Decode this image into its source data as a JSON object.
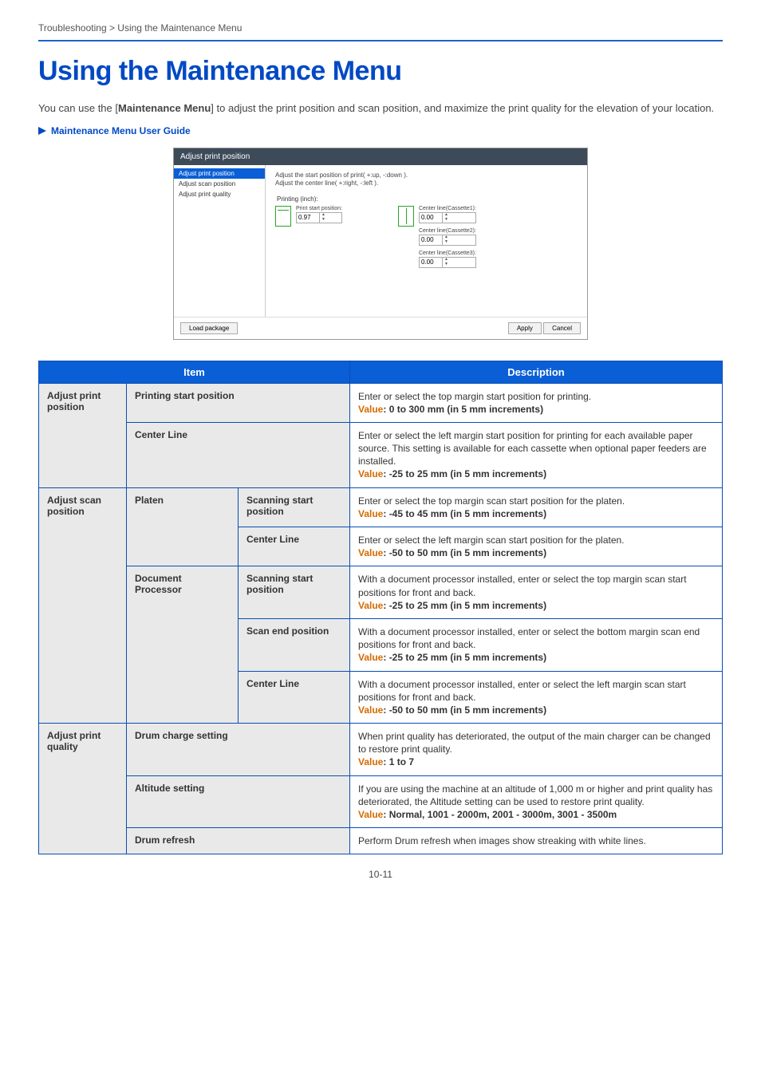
{
  "breadcrumb": "Troubleshooting > Using the Maintenance Menu",
  "title": "Using the Maintenance Menu",
  "intro_pre": "You can use the [",
  "intro_bold": "Maintenance Menu",
  "intro_post": "] to adjust the print position and scan position, and maximize the print quality for the elevation of your location.",
  "guide_link": "Maintenance Menu User Guide",
  "page_number": "10-11",
  "shot": {
    "title": "Adjust print position",
    "side": [
      "Adjust print position",
      "Adjust scan position",
      "Adjust print quality"
    ],
    "hint1": "Adjust the start position of print( +:up, -:down ).",
    "hint2": "Adjust the center line( +:right, -:left ).",
    "section": "Printing (inch):",
    "f_start_label": "Print start position:",
    "f_start_val": "0.97",
    "c1_label": "Center line(Cassette1):",
    "c1_val": "0.00",
    "c2_label": "Center line(Cassette2):",
    "c2_val": "0.00",
    "c3_label": "Center line(Cassette3):",
    "c3_val": "0.00",
    "btn_load": "Load package",
    "btn_apply": "Apply",
    "btn_cancel": "Cancel"
  },
  "table": {
    "head_item": "Item",
    "head_desc": "Description",
    "rows": {
      "r1": {
        "g": "Adjust print position",
        "sub": "Printing start position",
        "desc": "Enter or select the top margin start position for printing.",
        "val": ": 0 to 300 mm (in 5 mm increments)"
      },
      "r2": {
        "sub": "Center Line",
        "desc": "Enter or select the left margin start position for printing for each available paper source. This setting is available for each cassette when optional paper feeders are installed.",
        "val": ": -25 to 25 mm (in 5 mm increments)"
      },
      "r3": {
        "g": "Adjust scan position",
        "sub1": "Platen",
        "sub2": "Scanning start position",
        "desc": "Enter or select the top margin scan start position for the platen.",
        "val": ": -45 to 45 mm (in 5 mm increments)"
      },
      "r4": {
        "sub2": "Center Line",
        "desc": "Enter or select the left margin scan start position for the platen.",
        "val": ": -50 to 50 mm (in 5 mm increments)"
      },
      "r5": {
        "sub1": "Document Processor",
        "sub2": "Scanning start position",
        "desc": "With a document processor installed, enter or select the top margin scan start positions for front and back.",
        "val": ": -25 to 25 mm (in 5 mm increments)"
      },
      "r6": {
        "sub2": "Scan end position",
        "desc": "With a document processor installed, enter or select the bottom margin scan end positions for front and back.",
        "val": ": -25 to 25 mm (in 5 mm increments)"
      },
      "r7": {
        "sub2": "Center Line",
        "desc": "With a document processor installed, enter or select the left margin scan start positions for front and back.",
        "val": ": -50 to 50 mm (in 5 mm increments)"
      },
      "r8": {
        "g": "Adjust print quality",
        "sub": "Drum charge setting",
        "desc": "When print quality has deteriorated, the output of the main charger can be changed to restore print quality.",
        "val": ": 1 to 7"
      },
      "r9": {
        "sub": "Altitude setting",
        "desc": "If you are using the machine at an altitude of 1,000 m or higher and print quality has deteriorated, the Altitude setting can be used to restore print quality.",
        "val": ": Normal, 1001 - 2000m, 2001 - 3000m, 3001 - 3500m"
      },
      "r10": {
        "sub": "Drum refresh",
        "desc": "Perform Drum refresh when images show streaking with white lines."
      }
    },
    "value_label": "Value"
  }
}
